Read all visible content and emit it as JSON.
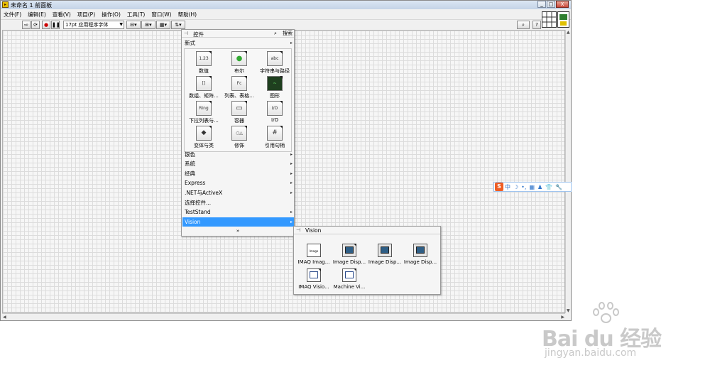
{
  "window": {
    "title": "未命名 1 前面板",
    "controls": [
      "_",
      "□",
      "X"
    ]
  },
  "menu": [
    "文件(F)",
    "编辑(E)",
    "查看(V)",
    "项目(P)",
    "操作(O)",
    "工具(T)",
    "窗口(W)",
    "帮助(H)"
  ],
  "toolbar": {
    "font_selector": "17pt 应用程序字体"
  },
  "controls_palette": {
    "title": "控件",
    "search_label": "搜索",
    "top_category": "新式",
    "icons": [
      {
        "label": "数值",
        "glyph": "1.23"
      },
      {
        "label": "布尔",
        "glyph": "●"
      },
      {
        "label": "字符串与路径",
        "glyph": "abc"
      },
      {
        "label": "数组、矩阵...",
        "glyph": "[]"
      },
      {
        "label": "列表、表格...",
        "glyph": "Fc"
      },
      {
        "label": "图形",
        "glyph": "~"
      },
      {
        "label": "下拉列表与...",
        "glyph": "Ring"
      },
      {
        "label": "容器",
        "glyph": "▭"
      },
      {
        "label": "I/O",
        "glyph": "I/O"
      },
      {
        "label": "变体与类",
        "glyph": "◆"
      },
      {
        "label": "修饰",
        "glyph": "○△"
      },
      {
        "label": "引用句柄",
        "glyph": "#"
      }
    ],
    "categories": [
      {
        "label": "银色",
        "submenu": true
      },
      {
        "label": "系统",
        "submenu": true
      },
      {
        "label": "经典",
        "submenu": true
      },
      {
        "label": "Express",
        "submenu": true
      },
      {
        "label": ".NET与ActiveX",
        "submenu": true
      },
      {
        "label": "选择控件...",
        "submenu": false
      },
      {
        "label": "TestStand",
        "submenu": true
      },
      {
        "label": "Vision",
        "submenu": true,
        "selected": true
      }
    ],
    "more_glyph": "»"
  },
  "vision_palette": {
    "title": "Vision",
    "icons": [
      {
        "label": "IMAQ Imag...",
        "glyph": "Image"
      },
      {
        "label": "Image Disp...",
        "glyph": ""
      },
      {
        "label": "Image Disp...",
        "glyph": ""
      },
      {
        "label": "Image Disp...",
        "glyph": ""
      },
      {
        "label": "IMAQ Visio...",
        "glyph": ""
      },
      {
        "label": "Machine Vi...",
        "glyph": ""
      }
    ]
  },
  "ime_bar": {
    "logo": "S",
    "items": [
      "中",
      "☽",
      "•,",
      "▦",
      "♟",
      "👕",
      "🔧"
    ]
  },
  "watermark": {
    "brand": "Bai du 经验",
    "url": "jingyan.baidu.com"
  },
  "colors": {
    "selection": "#3399ff",
    "canvas_grid": "#dcdcdc"
  }
}
